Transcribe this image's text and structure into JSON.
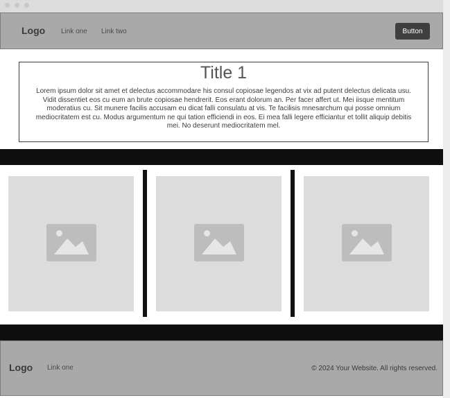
{
  "navbar": {
    "logo": "Logo",
    "links": [
      "Link one",
      "Link two"
    ],
    "button_label": "Button"
  },
  "hero": {
    "title": "Title 1",
    "text": "Lorem ipsum dolor sit amet et delectus accommodare his consul copiosae legendos at vix ad putent delectus delicata usu. Vidit dissentiet eos cu eum an brute copiosae hendrerit. Eos erant dolorum an. Per facer affert ut. Mei iisque mentitum moderatius cu. Sit munere facilis accusam eu dicat falli consulatu at vis. Te facilisis mnesarchum qui posse omnium mediocritatem est cu. Modus argumentum ne qui tation efficiendi in eos. Ei mea falli legere efficiantur et tollit aliquip debitis mei. No deserunt mediocritatem mel."
  },
  "gallery": {
    "icons": [
      "image-placeholder-icon",
      "image-placeholder-icon",
      "image-placeholder-icon"
    ]
  },
  "footer": {
    "logo": "Logo",
    "link": "Link one",
    "copyright": "© 2024 Your Website. All rights reserved."
  },
  "colors": {
    "bar_gray": "#a9a9a9",
    "button_dark": "#3f3f3f",
    "band_black": "#0f0f0f",
    "placeholder_gray": "#dcdcdc"
  }
}
